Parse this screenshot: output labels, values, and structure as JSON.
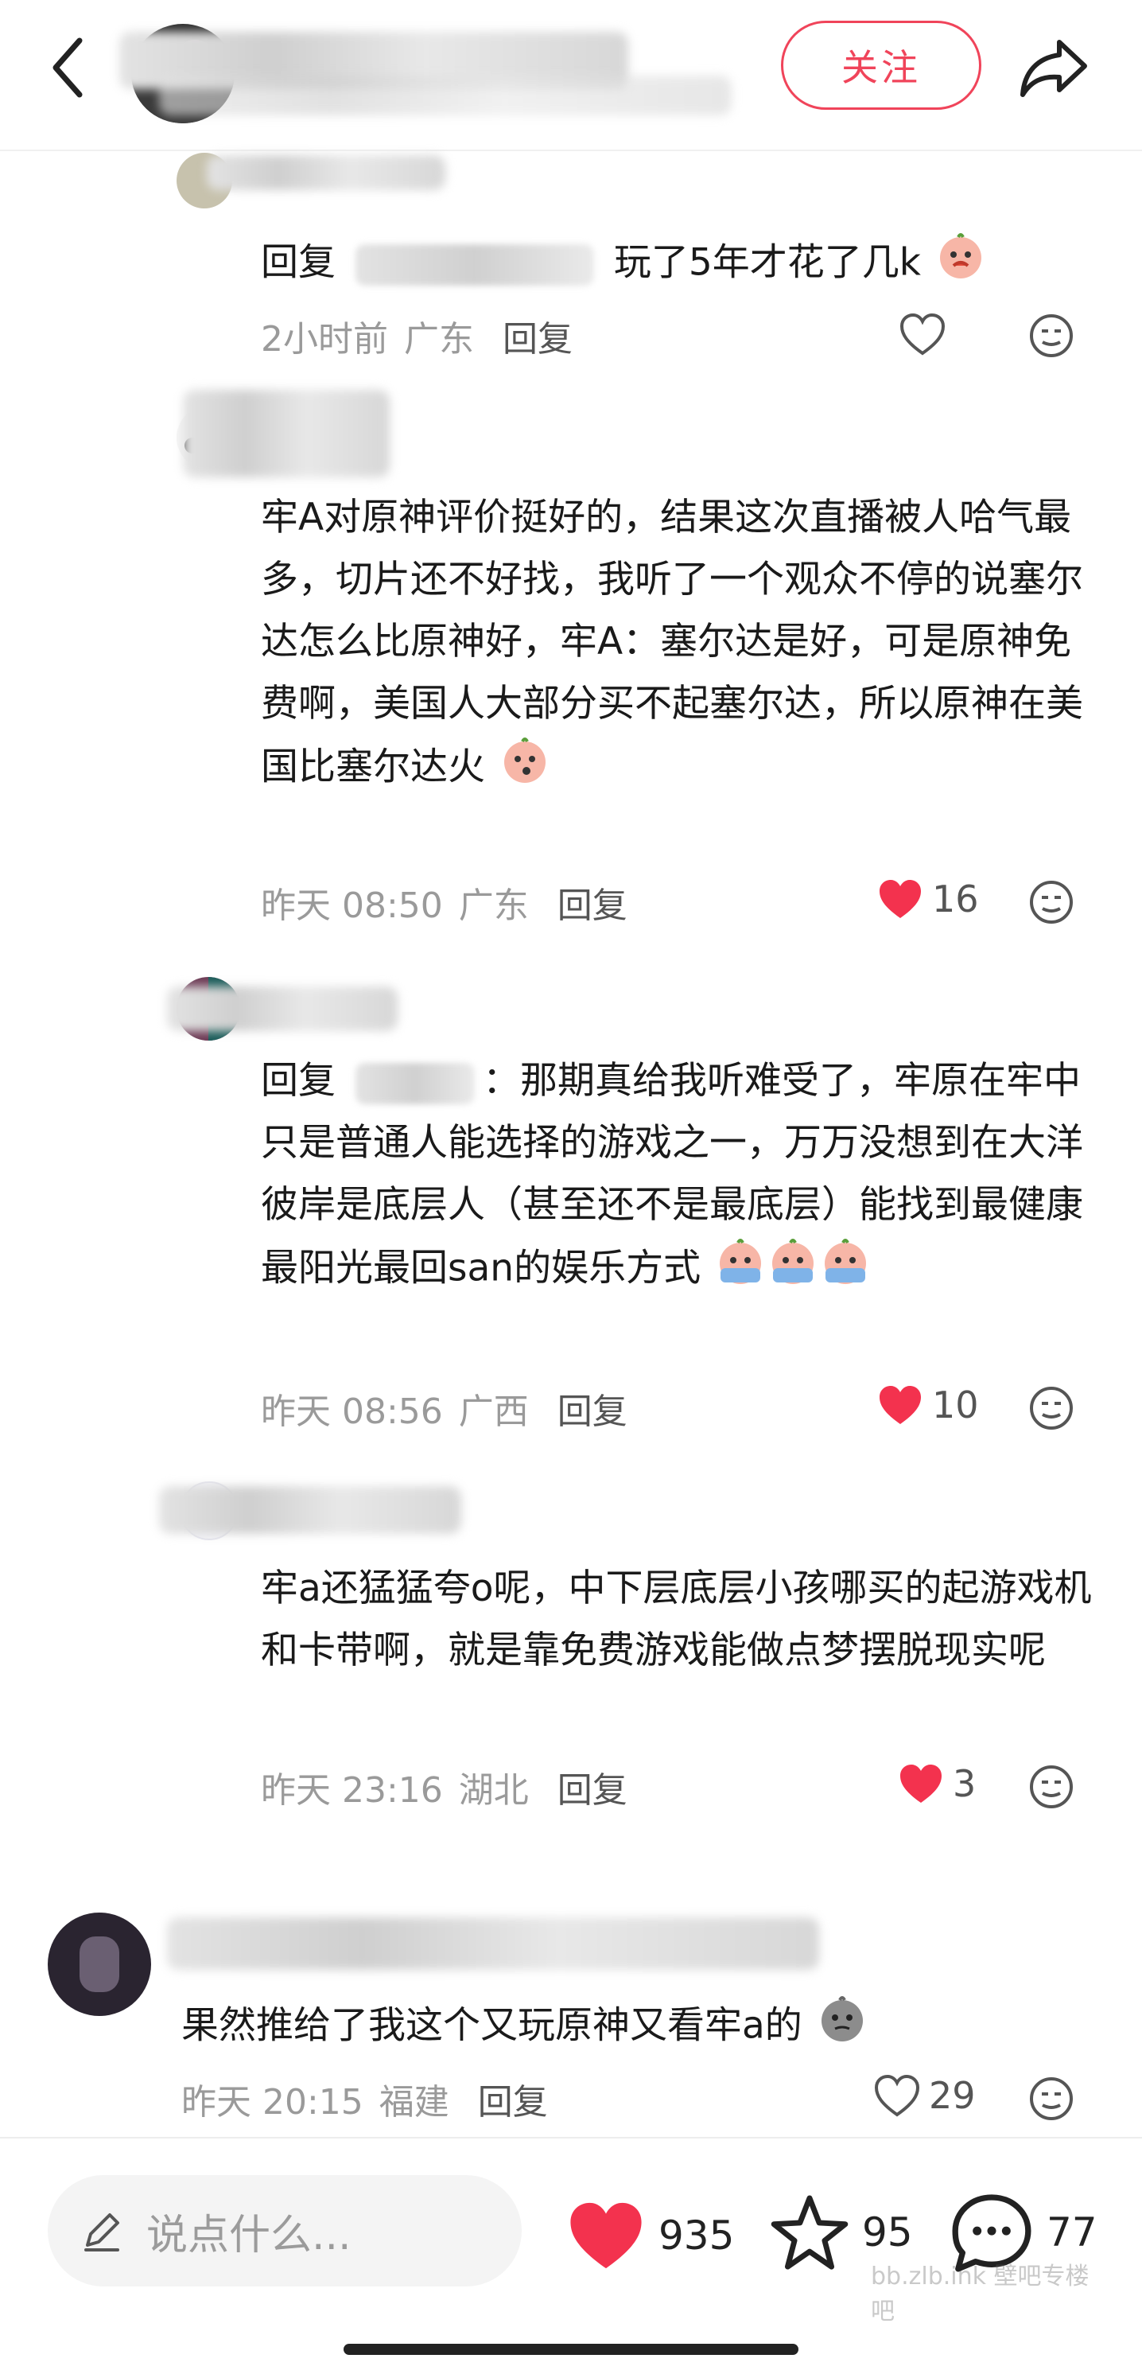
{
  "header": {
    "follow_label": "关注"
  },
  "comments": [
    {
      "text_prefix": "回复",
      "text_body": "玩了5年才花了几k",
      "time": "2小时前",
      "location": "广东",
      "reply_label": "回复"
    },
    {
      "text": "牢A对原神评价挺好的，结果这次直播被人哈气最多，切片还不好找，我听了一个观众不停的说塞尔达怎么比原神好，牢A：塞尔达是好，可是原神免费啊，美国人大部分买不起塞尔达，所以原神在美国比塞尔达火",
      "time": "昨天 08:50",
      "location": "广东",
      "reply_label": "回复",
      "likes": "16"
    },
    {
      "text_prefix": "回复",
      "text_body": "：那期真给我听难受了，牢原在牢中只是普通人能选择的游戏之一，万万没想到在大洋彼岸是底层人（甚至还不是最底层）能找到最健康最阳光最回san的娱乐方式",
      "time": "昨天 08:56",
      "location": "广西",
      "reply_label": "回复",
      "likes": "10"
    },
    {
      "text": "牢a还猛猛夸o呢，中下层底层小孩哪买的起游戏机和卡带啊，就是靠免费游戏能做点梦摆脱现实呢",
      "time": "昨天 23:16",
      "location": "湖北",
      "reply_label": "回复",
      "likes": "3"
    },
    {
      "text": "果然推给了我这个又玩原神又看牢a的",
      "time": "昨天 20:15",
      "location": "福建",
      "reply_label": "回复",
      "likes": "29"
    }
  ],
  "bottom": {
    "input_placeholder": "说点什么...",
    "likes": "935",
    "stars": "95",
    "comments": "77",
    "watermark": "bb.zlb.ink 壁吧专楼吧"
  },
  "colors": {
    "accent": "#f0445a",
    "like_red": "#f3324e",
    "muted": "#9a9a9a"
  }
}
